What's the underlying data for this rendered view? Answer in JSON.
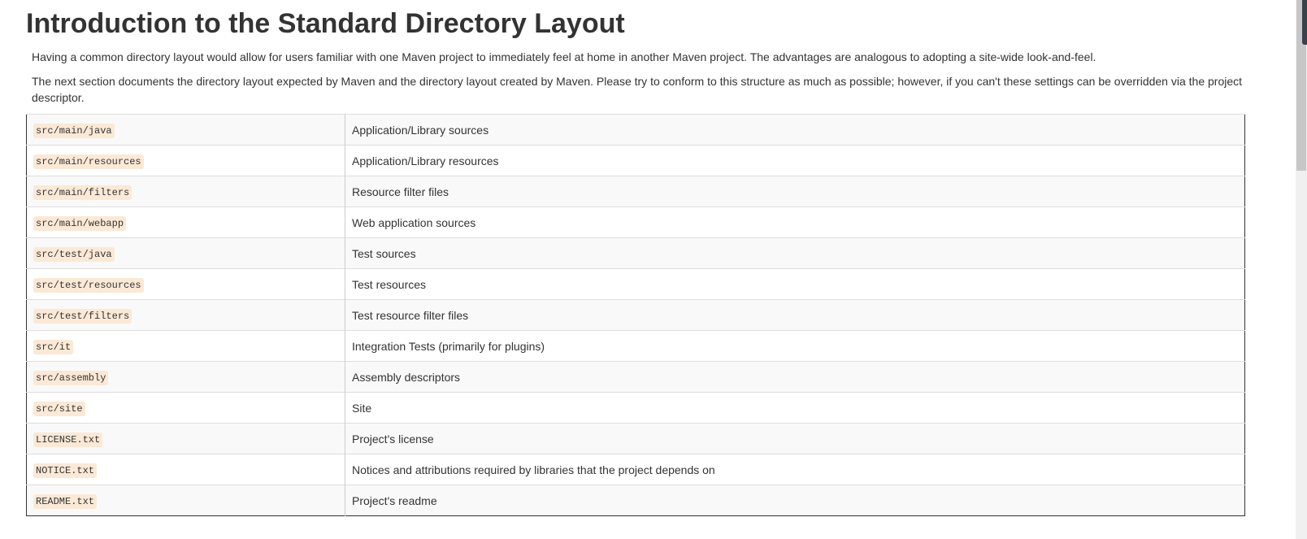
{
  "page": {
    "title": "Introduction to the Standard Directory Layout",
    "paragraphs": [
      "Having a common directory layout would allow for users familiar with one Maven project to immediately feel at home in another Maven project. The advantages are analogous to adopting a site-wide look-and-feel.",
      "The next section documents the directory layout expected by Maven and the directory layout created by Maven. Please try to conform to this structure as much as possible; however, if you can't these settings can be overridden via the project descriptor."
    ]
  },
  "table": {
    "rows": [
      {
        "path": "src/main/java",
        "description": "Application/Library sources"
      },
      {
        "path": "src/main/resources",
        "description": "Application/Library resources"
      },
      {
        "path": "src/main/filters",
        "description": "Resource filter files"
      },
      {
        "path": "src/main/webapp",
        "description": "Web application sources"
      },
      {
        "path": "src/test/java",
        "description": "Test sources"
      },
      {
        "path": "src/test/resources",
        "description": "Test resources"
      },
      {
        "path": "src/test/filters",
        "description": "Test resource filter files"
      },
      {
        "path": "src/it",
        "description": "Integration Tests (primarily for plugins)"
      },
      {
        "path": "src/assembly",
        "description": "Assembly descriptors"
      },
      {
        "path": "src/site",
        "description": "Site"
      },
      {
        "path": "LICENSE.txt",
        "description": "Project's license"
      },
      {
        "path": "NOTICE.txt",
        "description": "Notices and attributions required by libraries that the project depends on"
      },
      {
        "path": "README.txt",
        "description": "Project's readme"
      }
    ]
  },
  "colors": {
    "text": "#333333",
    "code_background": "#fbe9d6",
    "row_stripe": "#f9f9f9"
  }
}
